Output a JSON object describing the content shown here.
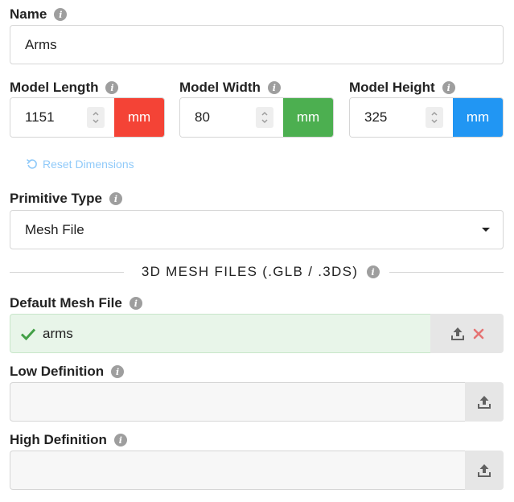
{
  "name_field": {
    "label": "Name",
    "value": "Arms"
  },
  "dimensions": [
    {
      "label": "Model Length",
      "value": "1151",
      "unit": "mm",
      "unit_color": "#f44336"
    },
    {
      "label": "Model Width",
      "value": "80",
      "unit": "mm",
      "unit_color": "#4caf50"
    },
    {
      "label": "Model Height",
      "value": "325",
      "unit": "mm",
      "unit_color": "#2196f3"
    }
  ],
  "reset_label": "Reset Dimensions",
  "primitive": {
    "label": "Primitive Type",
    "value": "Mesh File"
  },
  "mesh_section": {
    "title": "3D MESH FILES (.GLB / .3DS)"
  },
  "mesh_files": {
    "default": {
      "label": "Default Mesh File",
      "value": "arms",
      "status": "loaded"
    },
    "low": {
      "label": "Low Definition",
      "value": ""
    },
    "high": {
      "label": "High Definition",
      "value": ""
    }
  },
  "colors": {
    "success_bg": "#e8f5e9",
    "check": "#43a047",
    "remove": "#e57373",
    "link": "#90caf9"
  },
  "icons": {
    "info": "info-icon",
    "upload": "upload-icon",
    "remove": "close-icon",
    "check": "check-icon",
    "reset": "undo-icon",
    "dropdown": "caret-down-icon"
  }
}
